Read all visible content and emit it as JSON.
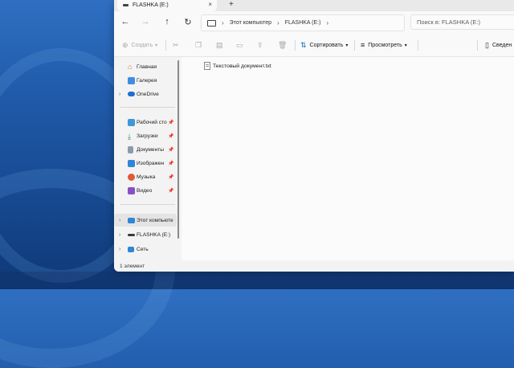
{
  "colors": {
    "accent": "#0067c0",
    "desktop": "#1f59a8"
  },
  "tab": {
    "title": "FLASHKA (E:)",
    "close": "×",
    "new": "+"
  },
  "nav_buttons": {
    "back": "←",
    "forward": "→",
    "up": "↑",
    "refresh": "↻"
  },
  "breadcrumb": {
    "sep1": "›",
    "part1": "Этот компьютер",
    "sep2": "›",
    "part2": "FLASHKA (E:)",
    "sep3": "›"
  },
  "search": {
    "placeholder": "Поиск в: FLASHKA (E:)"
  },
  "toolbar": {
    "create_label": "Создать",
    "sort_label": "Сортировать",
    "view_label": "Просмотреть",
    "details_label": "Сведен"
  },
  "sidebar": {
    "items": [
      {
        "label": "Главная",
        "icon": "home-icon"
      },
      {
        "label": "Галерея",
        "icon": "gallery-icon"
      },
      {
        "label": "OneDrive",
        "icon": "cloud-icon"
      },
      {
        "label": "Рабочий сто",
        "icon": "desktop-icon"
      },
      {
        "label": "Загрузки",
        "icon": "download-icon"
      },
      {
        "label": "Документы",
        "icon": "documents-icon"
      },
      {
        "label": "Изображен",
        "icon": "pictures-icon"
      },
      {
        "label": "Музыка",
        "icon": "music-icon"
      },
      {
        "label": "Видео",
        "icon": "video-icon"
      },
      {
        "label": "Этот компьюте",
        "icon": "pc-icon"
      },
      {
        "label": "FLASHKA (E:)",
        "icon": "drive-icon"
      },
      {
        "label": "Сеть",
        "icon": "network-icon"
      }
    ]
  },
  "files": [
    {
      "name": "Текстовый документ.txt",
      "icon": "text-file-icon"
    }
  ],
  "status": {
    "count": "1 элемент"
  }
}
